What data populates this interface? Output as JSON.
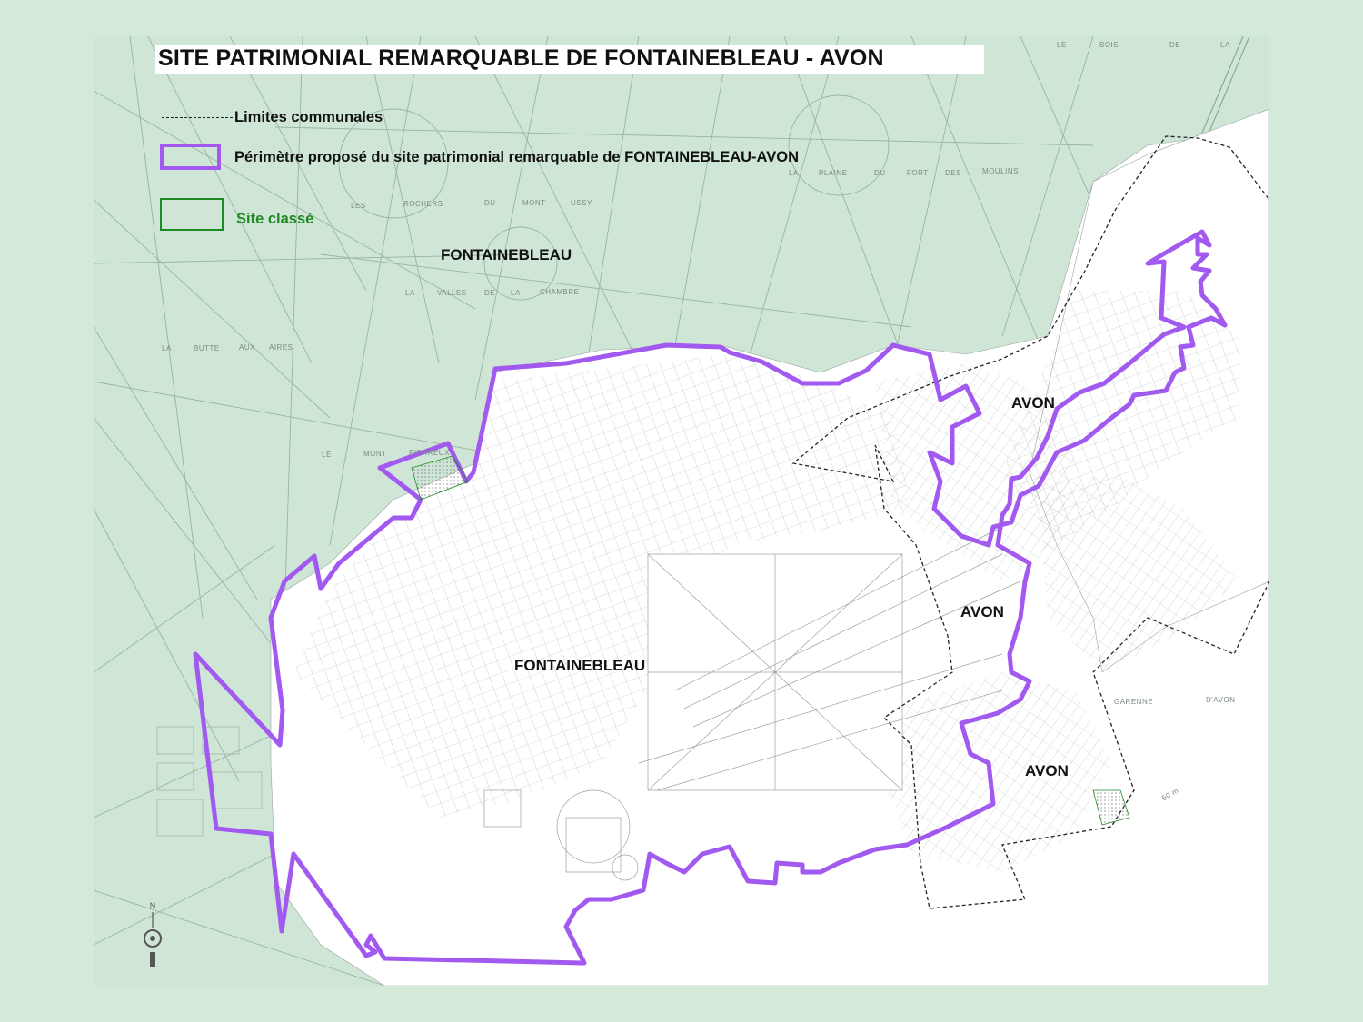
{
  "title": "SITE PATRIMONIAL REMARQUABLE DE FONTAINEBLEAU - AVON",
  "legend": {
    "communal_limits": "Limites communales",
    "perimeter": "Périmètre proposé du site patrimonial remarquable de FONTAINEBLEAU-AVON",
    "classified_site": "Site classé"
  },
  "places": {
    "fontainebleau_north": "FONTAINEBLEAU",
    "fontainebleau_center": "FONTAINEBLEAU",
    "avon_1": "AVON",
    "avon_2": "AVON",
    "avon_3": "AVON"
  },
  "toponyms": {
    "le_bois_de_la": [
      "LE",
      "BOIS",
      "DE",
      "LA"
    ],
    "la_plaine": [
      "LA",
      "PLAINE",
      "DU",
      "FORT",
      "DES",
      "MOULINS"
    ],
    "rochers": [
      "LES",
      "ROCHERS",
      "DU",
      "MONT",
      "USSY"
    ],
    "vallee": [
      "LA",
      "VALLEE",
      "DE",
      "LA",
      "CHAMBRE"
    ],
    "butte": [
      "LA",
      "BUTTE",
      "AUX",
      "AIRES"
    ],
    "mont_pierreux": [
      "LE",
      "MONT",
      "PIERREUX"
    ],
    "garenne": [
      "GARENNE",
      "D'AVON"
    ],
    "scale": "50 m"
  },
  "compass": {
    "north": "N"
  },
  "colors": {
    "forest": "#cfe6d6",
    "page_bg": "#d4ead8",
    "perimeter": "#a259f0",
    "site_classe": "#1f8a24",
    "road": "#8aa795"
  }
}
